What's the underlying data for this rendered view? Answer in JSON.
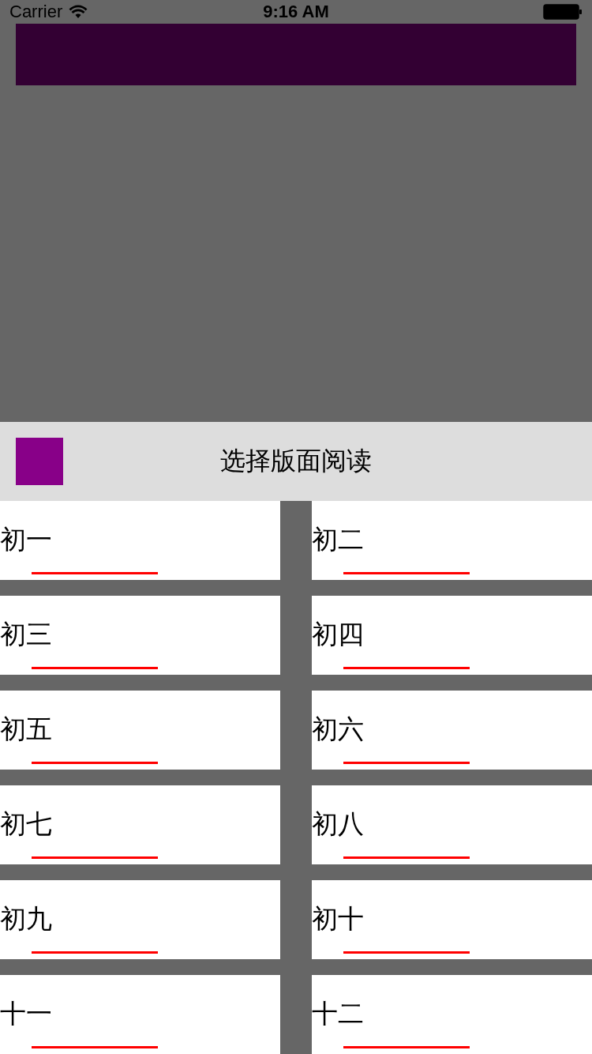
{
  "status_bar": {
    "carrier": "Carrier",
    "time": "9:16 AM"
  },
  "header": {
    "title": "选择版面阅读"
  },
  "pages": [
    {
      "label": "初一"
    },
    {
      "label": "初二"
    },
    {
      "label": "初三"
    },
    {
      "label": "初四"
    },
    {
      "label": "初五"
    },
    {
      "label": "初六"
    },
    {
      "label": "初七"
    },
    {
      "label": "初八"
    },
    {
      "label": "初九"
    },
    {
      "label": "初十"
    },
    {
      "label": "十一"
    },
    {
      "label": "十二"
    }
  ]
}
